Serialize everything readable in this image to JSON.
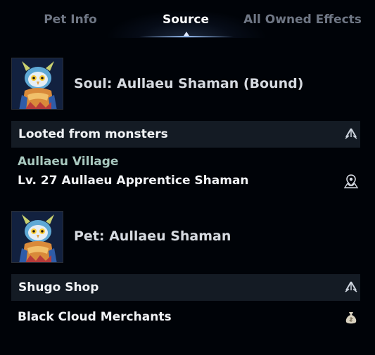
{
  "tabs": [
    {
      "label": "Pet Info",
      "active": false
    },
    {
      "label": "Source",
      "active": true
    },
    {
      "label": "All Owned Effects",
      "active": false
    }
  ],
  "items": [
    {
      "title": "Soul: Aullaeu Shaman (Bound)",
      "thumb_icon": "owl-shaman-portrait-icon",
      "source_type": "Looted from monsters",
      "source_type_icon": "expand-arrow-icon",
      "region": "Aullaeu Village",
      "source": "Lv. 27 Aullaeu Apprentice Shaman",
      "source_icon": "map-location-icon"
    },
    {
      "title": "Pet: Aullaeu Shaman",
      "thumb_icon": "owl-shaman-portrait-icon",
      "source_type": "Shugo Shop",
      "source_type_icon": "expand-arrow-icon",
      "source": "Black Cloud Merchants",
      "source_icon": "money-bag-icon"
    }
  ],
  "colors": {
    "background": "#000308",
    "section_bar": "#141b24",
    "region_text": "#a9c9c0",
    "active_tab": "#ffffff",
    "inactive_tab": "#6f7785"
  }
}
